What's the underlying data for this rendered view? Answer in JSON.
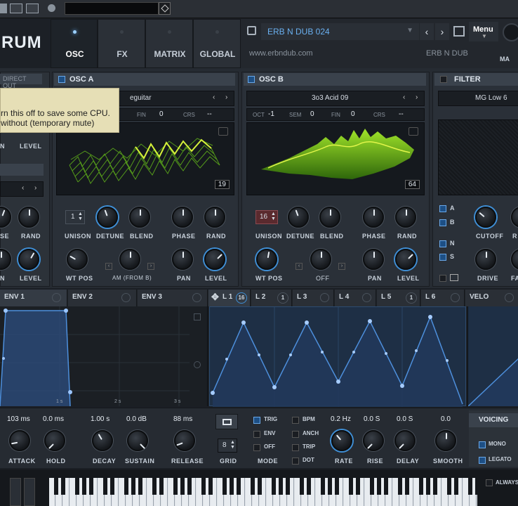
{
  "topbar": {
    "icons": [
      "grid-icon",
      "layout-icon",
      "circle-icon"
    ],
    "diamond": "diamond-icon"
  },
  "logo": "RUM",
  "main_tabs": [
    "OSC",
    "FX",
    "MATRIX",
    "GLOBAL"
  ],
  "preset": {
    "name": "ERB N DUB 024",
    "url": "www.erbndub.com",
    "author": "ERB N DUB",
    "menu": "Menu",
    "master_label": "MA"
  },
  "tooltip": {
    "line1": "rn this off to save some CPU.",
    "line2": "without (temporary mute)"
  },
  "left_partial": {
    "direct_out": "DIRECT OUT",
    "level": "LEVEL",
    "n": "N",
    "se": "SE",
    "rand": "RAND",
    "level2": "LEVEL"
  },
  "osc_a": {
    "title": "OSC A",
    "wavetable": "eguitar",
    "fin_label": "FIN",
    "fin": "0",
    "crs_label": "CRS",
    "crs": "--",
    "frame": "19",
    "unison": "1",
    "labels": [
      "UNISON",
      "DETUNE",
      "BLEND",
      "PHASE",
      "RAND"
    ],
    "labels2": [
      "WT POS",
      "AM (FROM B)",
      "PAN",
      "LEVEL"
    ],
    "zero": "0"
  },
  "osc_b": {
    "title": "OSC B",
    "wavetable": "3o3 Acid 09",
    "oct_label": "OCT",
    "oct": "-1",
    "sem_label": "SEM",
    "sem": "0",
    "fin_label": "FIN",
    "fin": "0",
    "crs_label": "CRS",
    "crs": "--",
    "frame": "64",
    "unison": "16",
    "labels": [
      "UNISON",
      "DETUNE",
      "BLEND",
      "PHASE",
      "RAND"
    ],
    "labels2": [
      "WT POS",
      "OFF",
      "PAN",
      "LEVEL"
    ]
  },
  "filter": {
    "title": "FILTER",
    "type": "MG Low 6",
    "routes": [
      "A",
      "B",
      "N",
      "S"
    ],
    "labels": [
      "CUTOFF",
      "R"
    ],
    "labels2": [
      "DRIVE",
      "FA"
    ]
  },
  "mod_tabs": {
    "env": [
      "ENV 1",
      "ENV 2",
      "ENV 3"
    ],
    "lfo": [
      "L 1",
      "L 2",
      "L 3",
      "L 4",
      "L 5",
      "L 6"
    ],
    "l1_num": "16",
    "l2_num": "1",
    "l5_num": "1",
    "velo": "VELO"
  },
  "env_times": [
    "1 s",
    "2 s",
    "3 s"
  ],
  "env_params": {
    "values": [
      "103 ms",
      "0.0 ms",
      "1.00 s",
      "0.0 dB",
      "88 ms"
    ],
    "labels": [
      "ATTACK",
      "HOLD",
      "DECAY",
      "SUSTAIN",
      "RELEASE"
    ]
  },
  "grid": {
    "value": "8",
    "label": "GRID"
  },
  "mode": {
    "options": [
      "TRIG",
      "ENV",
      "OFF"
    ],
    "label": "MODE"
  },
  "lfo_opts": {
    "options": [
      "BPM",
      "ANCH",
      "TRIP",
      "DOT"
    ]
  },
  "lfo_params": {
    "values": [
      "0.2 Hz",
      "0.0 S",
      "0.0 S",
      "0.0"
    ],
    "labels": [
      "RATE",
      "RISE",
      "DELAY",
      "SMOOTH"
    ]
  },
  "voicing": {
    "title": "VOICING",
    "mono": "MONO",
    "legato": "LEGATO",
    "always": "ALWAYS"
  },
  "colors": {
    "accent": "#3f8fd6",
    "wave_green": "#7fd41e",
    "lfo_line": "#4d8fdc"
  }
}
